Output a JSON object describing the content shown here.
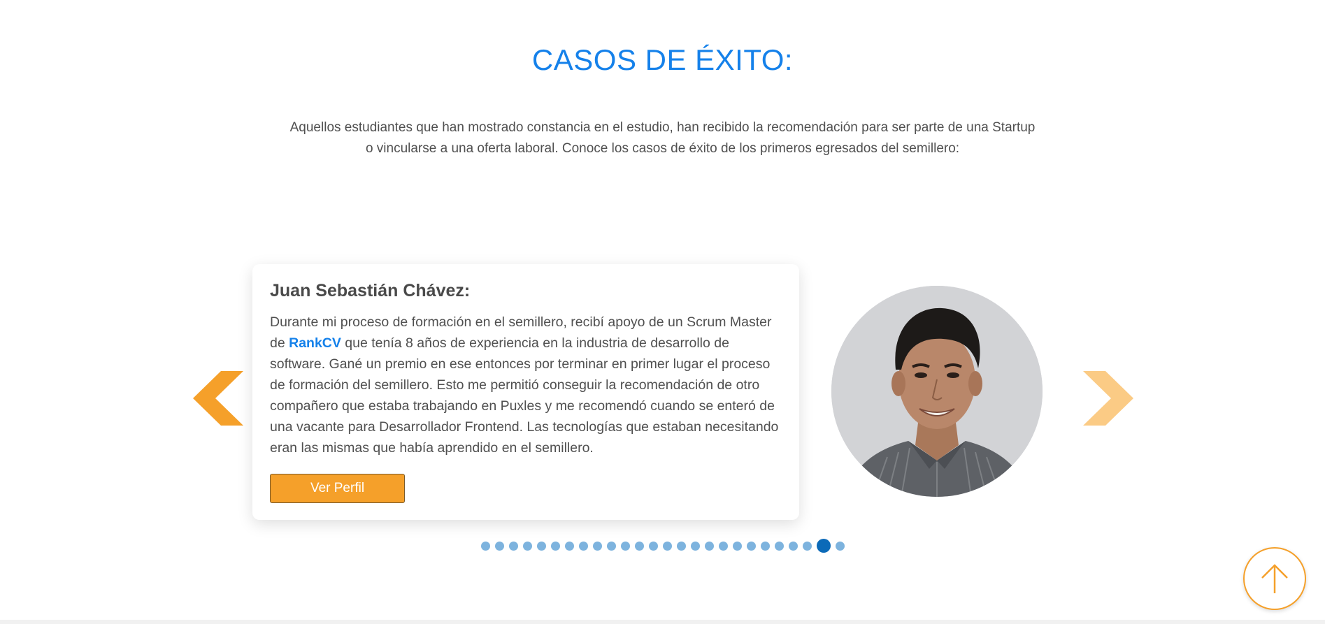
{
  "section": {
    "title": "CASOS DE ÉXITO:",
    "intro": "Aquellos estudiantes que han mostrado constancia en el estudio, han recibido la recomendación para ser parte de una Startup o vincularse a una oferta laboral. Conoce los casos de éxito de los primeros egresados del semillero:"
  },
  "testimonial": {
    "name": "Juan Sebastián Chávez:",
    "body_part1": "Durante mi proceso de formación en el semillero, recibí apoyo de un Scrum Master de ",
    "link_text": "RankCV",
    "body_part2": " que tenía 8 años de experiencia en la industria de desarrollo de software. Gané un premio en ese entonces por terminar en primer lugar el proceso de formación del semillero. Esto me permitió conseguir la recomendación de otro compañero que estaba trabajando en Puxles y me recomendó cuando se enteró de una vacante para Desarrollador Frontend. Las tecnologías que estaban necesitando eran las mismas que había aprendido en el semillero.",
    "button_label": "Ver Perfil",
    "photo_alt": "Juan Sebastián Chávez"
  },
  "carousel": {
    "total_slides": 26,
    "active_index": 24,
    "prev_icon": "chevron-left-icon",
    "next_icon": "chevron-right-icon"
  },
  "colors": {
    "title_blue": "#1581ea",
    "accent_orange": "#f5a02a",
    "dot": "#7db3de",
    "dot_active": "#0b6ab8"
  },
  "scroll_top": {
    "icon": "arrow-up-icon"
  }
}
